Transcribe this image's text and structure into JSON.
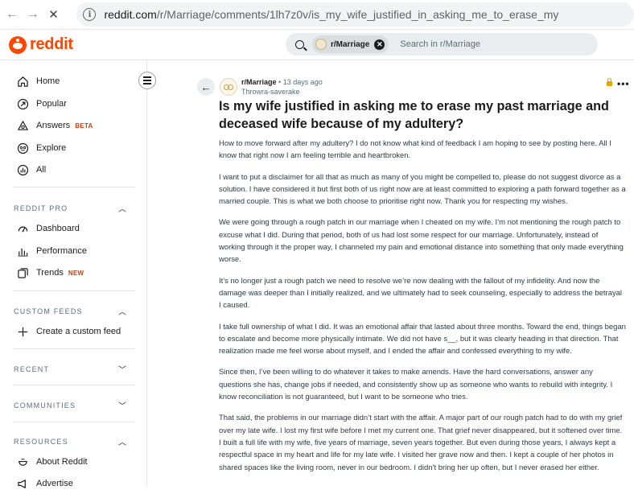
{
  "browser": {
    "url_host": "reddit.com",
    "url_path": "/r/Marriage/comments/1lh7z0v/is_my_wife_justified_in_asking_me_to_erase_my"
  },
  "header": {
    "logo_text": "reddit",
    "search_chip": "r/Marriage",
    "search_placeholder": "Search in r/Marriage"
  },
  "sidebar": {
    "main_items": [
      {
        "label": "Home",
        "icon": "home-icon"
      },
      {
        "label": "Popular",
        "icon": "popular-icon"
      },
      {
        "label": "Answers",
        "badge": "BETA",
        "icon": "answers-icon"
      },
      {
        "label": "Explore",
        "icon": "explore-icon"
      },
      {
        "label": "All",
        "icon": "all-icon"
      }
    ],
    "reddit_pro": {
      "heading": "REDDIT PRO",
      "items": [
        {
          "label": "Dashboard",
          "icon": "dashboard-icon"
        },
        {
          "label": "Performance",
          "icon": "performance-icon"
        },
        {
          "label": "Trends",
          "badge": "NEW",
          "icon": "trends-icon"
        }
      ]
    },
    "custom_feeds": {
      "heading": "CUSTOM FEEDS",
      "items": [
        {
          "label": "Create a custom feed",
          "icon": "plus-icon"
        }
      ]
    },
    "recent": {
      "heading": "RECENT"
    },
    "communities": {
      "heading": "COMMUNITIES"
    },
    "resources": {
      "heading": "RESOURCES",
      "items": [
        {
          "label": "About Reddit",
          "icon": "about-icon"
        },
        {
          "label": "Advertise",
          "icon": "advertise-icon"
        }
      ]
    }
  },
  "post": {
    "subreddit": "r/Marriage",
    "time": "13 days ago",
    "author": "Throwra-saverake",
    "title": "Is my wife justified in asking me to erase my past marriage and deceased wife because of my adultery?",
    "paragraphs": [
      "How to move forward after my adultery? I do not know what kind of feedback I am hoping to see by posting here. All I know that right now I am feeling terrible and heartbroken.",
      "I want to put a disclaimer for all that as much as many of you might be compelled to, please do not suggest divorce as a solution. I have considered it but first both of us right now are at least committed to exploring a path forward together as a married couple. This is what we both choose to prioritise right now. Thank you for respecting my wishes.",
      "We were going through a rough patch in our marriage when I cheated on my wife. I’m not mentioning the rough patch to excuse what I did. During that period, both of us had lost some respect for our marriage. Unfortunately, instead of working through it the proper way, I channeled my pain and emotional distance into something that only made everything worse.",
      "It’s no longer just a rough patch we need to resolve we’re now dealing with the fallout of my infidelity. And now the damage was deeper than I initially realized, and we ultimately had to seek counseling, especially to address the betrayal I caused.",
      "I take full ownership of what I did. It was an emotional affair that lasted about three months. Toward the end, things began to escalate and become more physically intimate. We did not have s__, but it was clearly heading in that direction. That realization made me feel worse about myself, and I ended the affair and confessed everything to my wife.",
      "Since then, I’ve been willing to do whatever it takes to make amends. Have the hard conversations, answer any questions she has, change jobs if needed, and consistently show up as someone who wants to rebuild with integrity. I know reconciliation is not guaranteed, but I want to be someone who tries.",
      "That said, the problems in our marriage didn’t start with the affair. A major part of our rough patch had to do with my grief over my late wife. I lost my first wife before I met my current one. That grief never disappeared, but it softened over time. I built a full life with my wife, five years of marriage, seven years together. But even during those years, I always kept a respectful space in my heart and life for my late wife. I visited her grave now and then. I kept a couple of her photos in shared spaces like the living room, never in our bedroom. I didn’t bring her up often, but I never erased her either."
    ]
  }
}
